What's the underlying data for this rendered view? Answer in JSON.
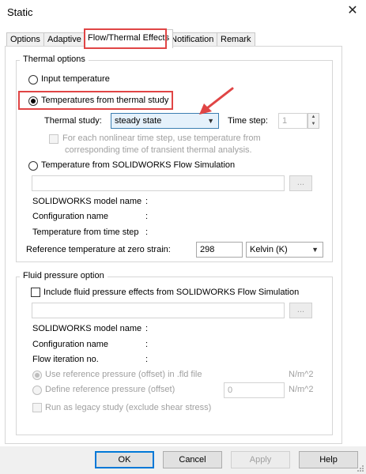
{
  "window": {
    "title": "Static"
  },
  "tabs": [
    {
      "label": "Options"
    },
    {
      "label": "Adaptive"
    },
    {
      "label": "Flow/Thermal Effects"
    },
    {
      "label": "Notification"
    },
    {
      "label": "Remark"
    }
  ],
  "thermal": {
    "legend": "Thermal options",
    "input_temperature": "Input temperature",
    "from_thermal_study": "Temperatures from thermal study",
    "thermal_study_label": "Thermal study:",
    "thermal_study_value": "steady state",
    "time_step_label": "Time step:",
    "time_step_value": "1",
    "nonlinear_line1": "For each nonlinear time step, use temperature from",
    "nonlinear_line2": "corresponding time of transient thermal analysis.",
    "from_flow_sim": "Temperature from SOLIDWORKS Flow Simulation",
    "browse": "...",
    "model_name_label": "SOLIDWORKS model name",
    "config_name_label": "Configuration name",
    "time_step_from_label": "Temperature from time step",
    "colon": ":",
    "ref_temp_label": "Reference temperature at zero strain:",
    "ref_temp_value": "298",
    "unit_value": "Kelvin (K)"
  },
  "fluid": {
    "legend": "Fluid pressure option",
    "include_label": "Include fluid pressure effects from SOLIDWORKS Flow Simulation",
    "browse": "...",
    "model_name_label": "SOLIDWORKS model name",
    "config_name_label": "Configuration name",
    "flow_iteration_label": "Flow iteration no.",
    "colon": ":",
    "use_ref_pressure": "Use reference pressure (offset) in .fld file",
    "use_ref_unit": "N/m^2",
    "define_ref_pressure": "Define reference pressure (offset)",
    "define_value": "0",
    "define_unit": "N/m^2",
    "legacy_label": "Run as legacy study (exclude shear stress)"
  },
  "footer": {
    "ok": "OK",
    "cancel": "Cancel",
    "apply": "Apply",
    "help": "Help"
  },
  "colors": {
    "highlight": "#e04545",
    "select_active": "#e5f1fb",
    "default_button_border": "#0078d7"
  }
}
